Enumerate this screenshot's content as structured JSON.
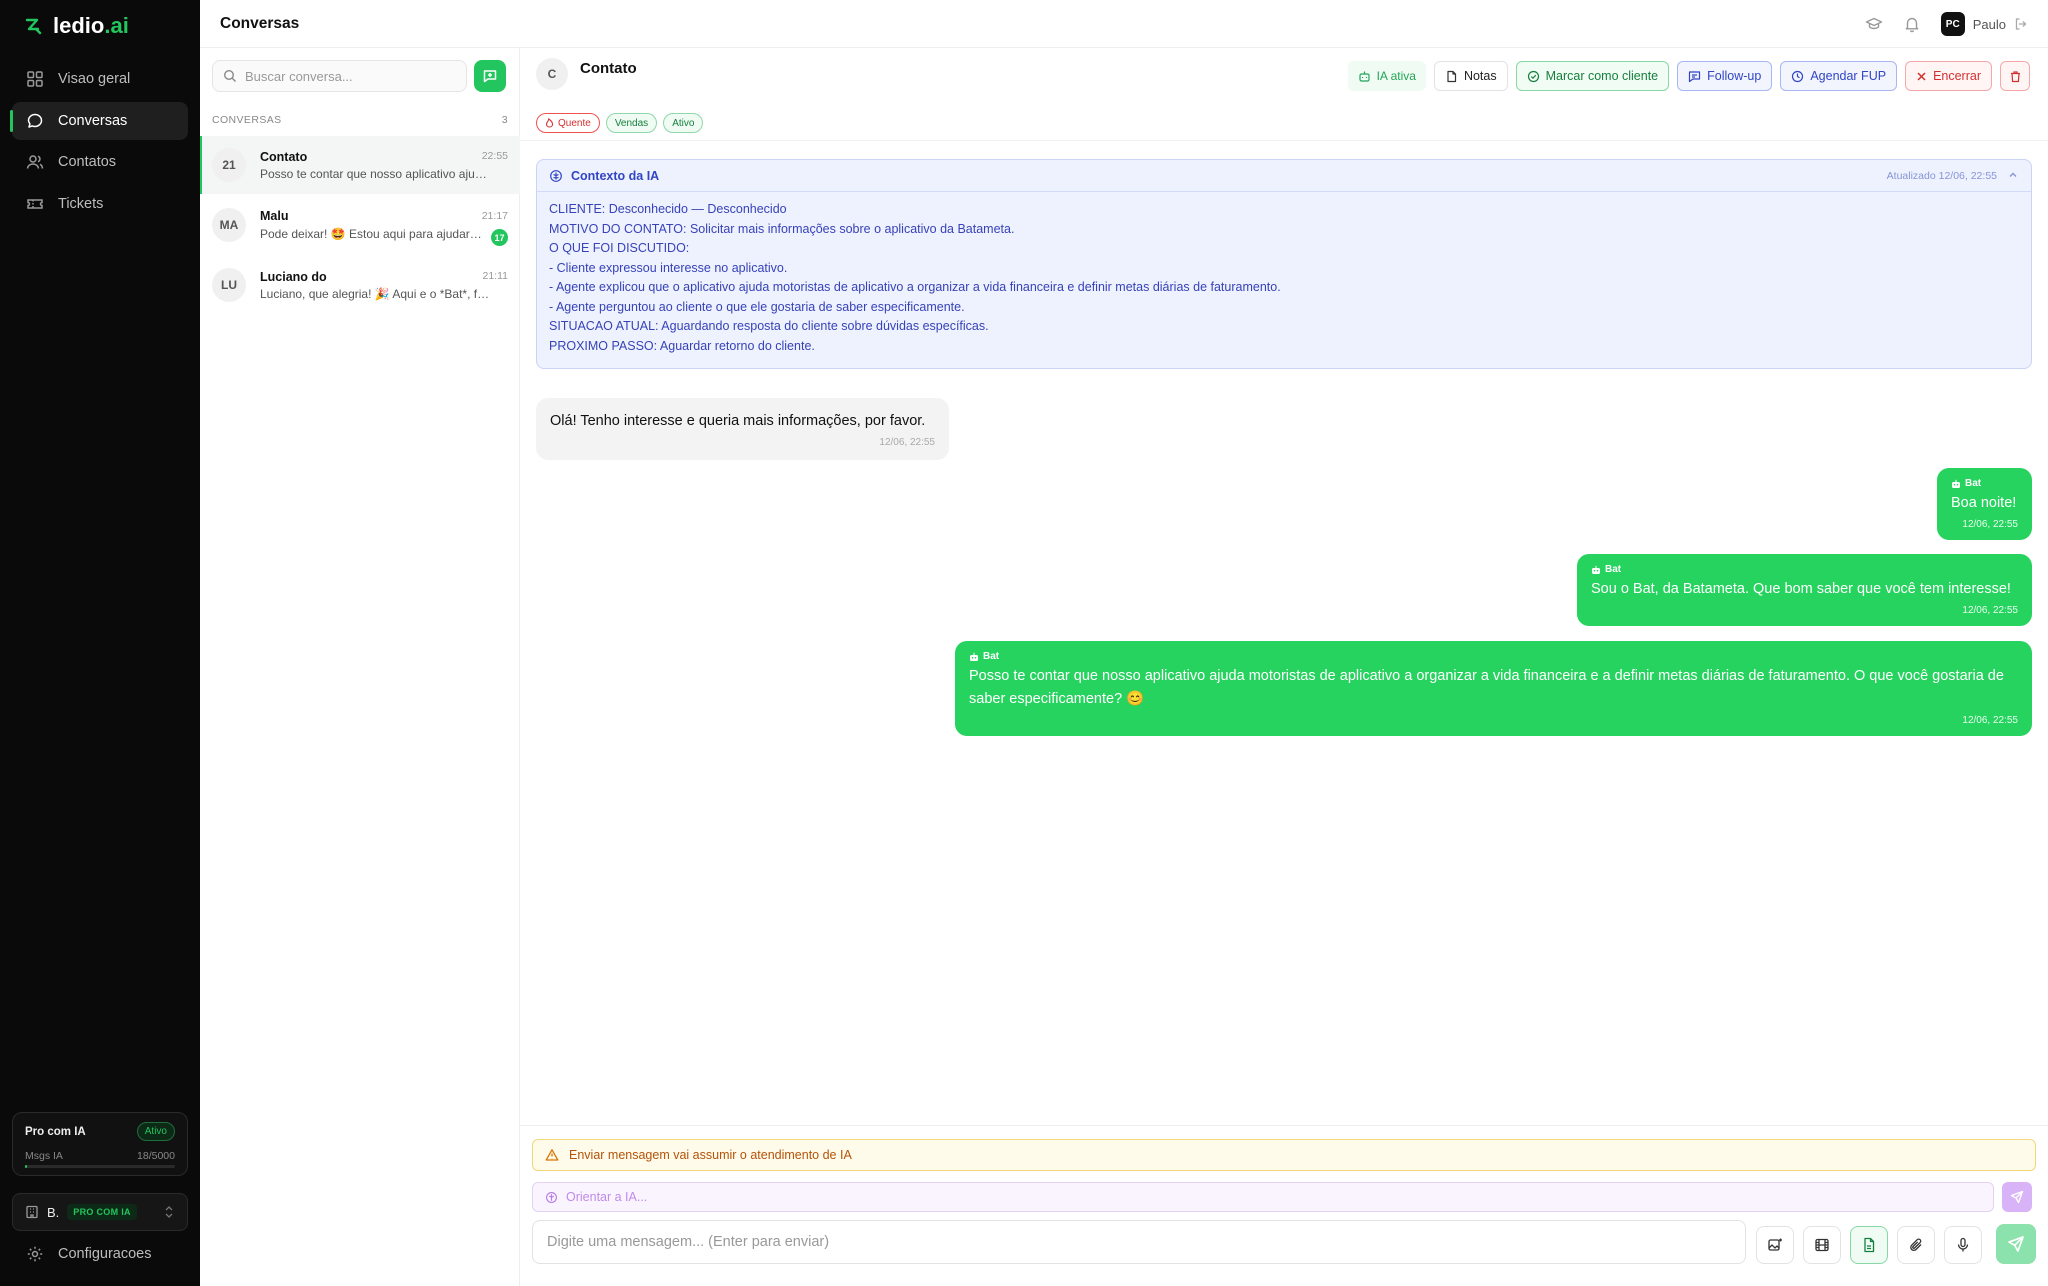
{
  "app": {
    "logo_main": "ledio",
    "logo_suffix": ".ai"
  },
  "sidebar": {
    "items": [
      {
        "label": "Visao geral",
        "icon": "grid-icon"
      },
      {
        "label": "Conversas",
        "icon": "chat-icon",
        "active": true
      },
      {
        "label": "Contatos",
        "icon": "users-icon"
      },
      {
        "label": "Tickets",
        "icon": "ticket-icon"
      }
    ],
    "plan": {
      "name": "Pro com IA",
      "status": "Ativo",
      "msgs_label": "Msgs IA",
      "msgs_count": "18/5000",
      "usage_fraction": 0.0036
    },
    "account": {
      "name": "B.",
      "plan_badge": "PRO COM IA"
    },
    "settings_label": "Configuracoes"
  },
  "header": {
    "title": "Conversas",
    "user_initials": "PC",
    "user_name": "Paulo"
  },
  "conversation_list": {
    "search_placeholder": "Buscar conversa...",
    "section_label": "CONVERSAS",
    "count": "3",
    "items": [
      {
        "avatar": "21",
        "name": "Contato",
        "time": "22:55",
        "preview": "Posso te contar que nosso aplicativo ajuda motoristas de aplicativo a organizar",
        "unread": "",
        "active": true
      },
      {
        "avatar": "MA",
        "name": "Malu",
        "time": "21:17",
        "preview": "Pode deixar! 🤩 Estou aqui para ajudar no que precisar",
        "unread": "17",
        "active": false
      },
      {
        "avatar": "LU",
        "name": "Luciano do",
        "time": "21:11",
        "preview": "Luciano, que alegria! 🎉 Aqui e o *Bat*, fico feliz",
        "unread": "",
        "active": false
      }
    ]
  },
  "chat": {
    "contact_initial": "C",
    "contact_name": "Contato",
    "actions": {
      "ia_status": "IA ativa",
      "notes": "Notas",
      "mark_client": "Marcar como cliente",
      "follow_up": "Follow-up",
      "schedule_fup": "Agendar FUP",
      "close": "Encerrar"
    },
    "tags": [
      "Quente",
      "Vendas",
      "Ativo"
    ],
    "context": {
      "title": "Contexto da IA",
      "updated": "Atualizado 12/06, 22:55",
      "lines": [
        "CLIENTE: Desconhecido — Desconhecido",
        "MOTIVO DO CONTATO: Solicitar mais informações sobre o aplicativo da Batameta.",
        "O QUE FOI DISCUTIDO:",
        "- Cliente expressou interesse no aplicativo.",
        "- Agente explicou que o aplicativo ajuda motoristas de aplicativo a organizar a vida financeira e definir metas diárias de faturamento.",
        "- Agente perguntou ao cliente o que ele gostaria de saber especificamente.",
        "SITUACAO ATUAL: Aguardando resposta do cliente sobre dúvidas específicas.",
        "PROXIMO PASSO: Aguardar retorno do cliente."
      ]
    },
    "messages": [
      {
        "direction": "in",
        "sender": "",
        "text": "Olá! Tenho interesse e queria mais informações, por favor.",
        "time": "12/06, 22:55"
      },
      {
        "direction": "out",
        "sender": "Bat",
        "text": "Boa noite!",
        "time": "12/06, 22:55"
      },
      {
        "direction": "out",
        "sender": "Bat",
        "text": "Sou o Bat, da Batameta. Que bom saber que você tem interesse!",
        "time": "12/06, 22:55"
      },
      {
        "direction": "out",
        "sender": "Bat",
        "text": "Posso te contar que nosso aplicativo ajuda motoristas de aplicativo a organizar a vida financeira e a definir metas diárias de faturamento. O que você gostaria de saber especificamente? 😊",
        "time": "12/06, 22:55"
      }
    ],
    "composer": {
      "warning": "Enviar mensagem vai assumir o atendimento de IA",
      "guide_placeholder": "Orientar a IA...",
      "message_placeholder": "Digite uma mensagem... (Enter para enviar)"
    }
  },
  "colors": {
    "brand_green": "#22c55e",
    "sidebar_bg": "#0a0a0a",
    "context_bg": "#eef2fe",
    "outgoing_bubble": "#27d35f"
  }
}
